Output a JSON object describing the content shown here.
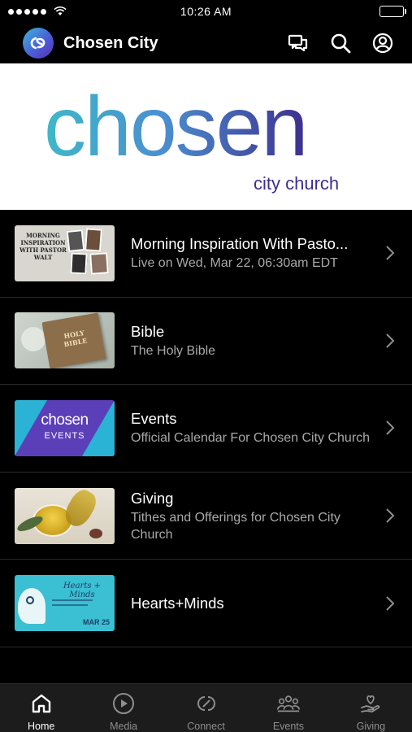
{
  "status_bar": {
    "time": "10:26 AM"
  },
  "header": {
    "title": "Chosen City",
    "icons": [
      "messages-icon",
      "search-icon",
      "account-icon"
    ]
  },
  "banner": {
    "logo_word": "chosen",
    "logo_tagline": "city church",
    "colors": {
      "teal": "#3fb8c9",
      "purple": "#3d2f8f"
    }
  },
  "list": [
    {
      "title": "Morning Inspiration With Pasto...",
      "subtitle": "Live on Wed, Mar 22, 06:30am EDT",
      "thumb_text": "MORNING INSPIRATION WITH PASTOR WALT"
    },
    {
      "title": "Bible",
      "subtitle": "The Holy Bible",
      "thumb_text": "HOLY BIBLE"
    },
    {
      "title": "Events",
      "subtitle": "Official Calendar For Chosen City Church",
      "thumb_text": "chosen",
      "thumb_subtext": "EVENTS"
    },
    {
      "title": "Giving",
      "subtitle": "Tithes and Offerings for Chosen City Church",
      "thumb_text": ""
    },
    {
      "title": "Hearts+Minds",
      "subtitle": "",
      "thumb_text": "Hearts + Minds",
      "thumb_subtext": "MAR 25"
    }
  ],
  "tabs": [
    {
      "label": "Home",
      "icon": "home-icon",
      "active": true
    },
    {
      "label": "Media",
      "icon": "play-circle-icon",
      "active": false
    },
    {
      "label": "Connect",
      "icon": "connect-icon",
      "active": false
    },
    {
      "label": "Events",
      "icon": "people-icon",
      "active": false
    },
    {
      "label": "Giving",
      "icon": "heart-hand-icon",
      "active": false
    }
  ]
}
